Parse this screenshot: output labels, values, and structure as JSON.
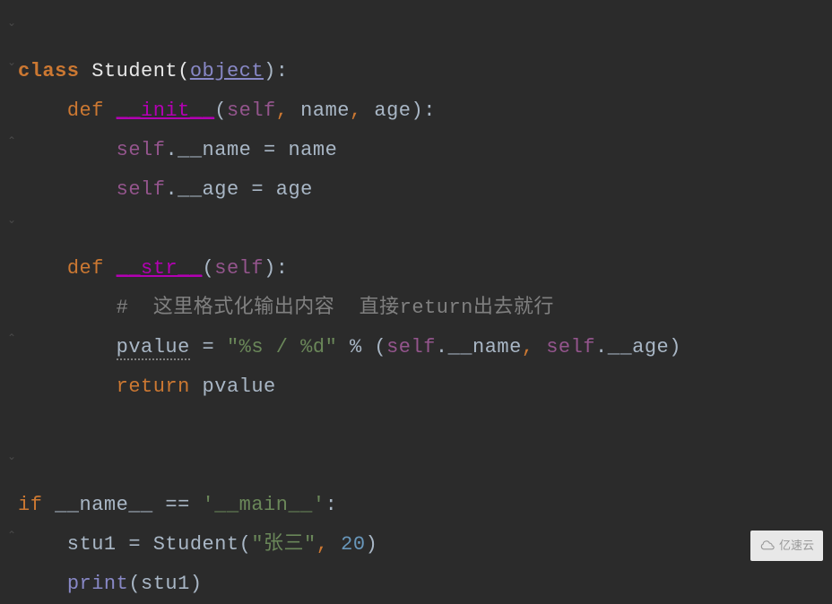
{
  "code": {
    "kw_class": "class",
    "classname": " Student(",
    "object": "object",
    "class_close": "):",
    "kw_def1": "def",
    "init": "__init__",
    "init_open": "(",
    "self1": "self",
    "comma1": ",",
    "name_param": " name",
    "comma2": ",",
    "age_param": " age):",
    "self2": "self",
    "l3_attr": ".__name = name",
    "self3": "self",
    "l4_attr": ".__age = age",
    "kw_def2": "def",
    "str_dunder": "__str__",
    "str_open": "(",
    "self4": "self",
    "str_close": "):",
    "comment": "#  这里格式化输出内容  直接return出去就行",
    "pvalue": "pvalue",
    "l8_assign": " = ",
    "fmt_string": "\"%s / %d\"",
    "l8_pct": " % (",
    "self5": "self",
    "l8_name": ".__name",
    "comma3": ",",
    "self6": "self",
    "l8_age": ".__age)",
    "kw_return": "return",
    "pvalue_ret": " pvalue",
    "kw_if": "if",
    "name_dunder": " __name__ == ",
    "main_str": "'__main__'",
    "if_close": ":",
    "stu_assign": "    stu1 = Student(",
    "zhang": "\"张三\"",
    "comma4": ",",
    "twenty": " 20",
    "stu_close": ")",
    "print": "print",
    "print_arg": "(stu1)"
  },
  "watermark": {
    "text": "亿速云"
  }
}
